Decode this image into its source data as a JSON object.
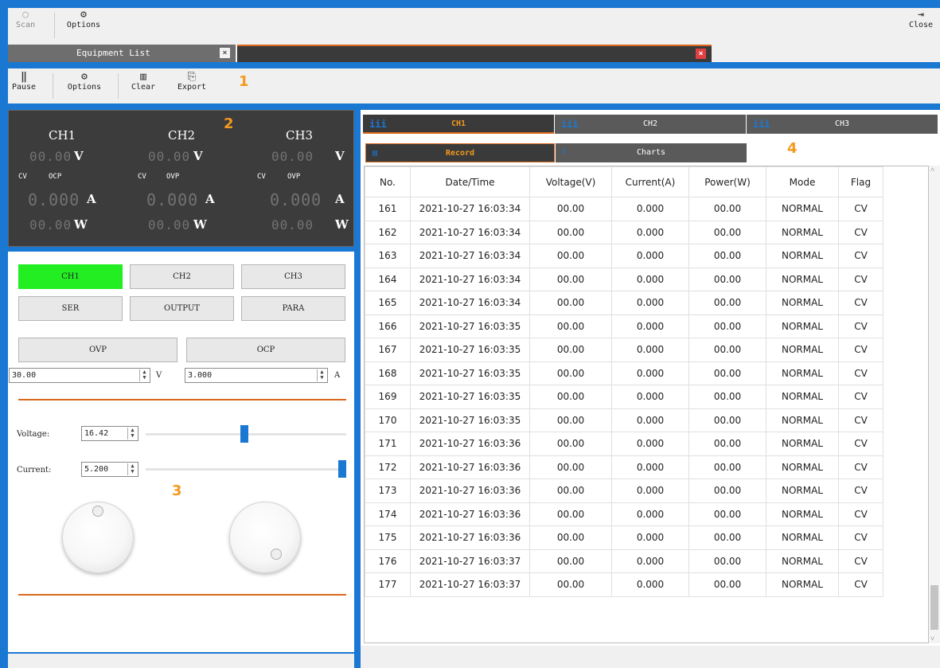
{
  "toolbar": {
    "scan": "Scan",
    "options": "Options",
    "close": "Close"
  },
  "tabs": {
    "equipment_list": "Equipment List"
  },
  "toolbar2": {
    "pause": "Pause",
    "options": "Options",
    "clear": "Clear",
    "export": "Export"
  },
  "markers": {
    "m1": "1",
    "m2": "2",
    "m3": "3",
    "m4": "4"
  },
  "display": {
    "channels": [
      {
        "name": "CH1",
        "voltage": "00.00",
        "mode": "CV",
        "prot": "OCP",
        "current": "0.000",
        "power": "00.00"
      },
      {
        "name": "CH2",
        "voltage": "00.00",
        "mode": "CV",
        "prot": "OVP",
        "current": "0.000",
        "power": "00.00"
      },
      {
        "name": "CH3",
        "voltage": "00.00",
        "mode": "CV",
        "prot": "OVP",
        "current": "0.000",
        "power": "00.00"
      }
    ],
    "units": {
      "v": "V",
      "a": "A",
      "w": "W"
    }
  },
  "control": {
    "ch1": "CH1",
    "ch2": "CH2",
    "ch3": "CH3",
    "ser": "SER",
    "output": "OUTPUT",
    "para": "PARA",
    "ovp": "OVP",
    "ocp": "OCP",
    "ovp_value": "30.00",
    "ocp_value": "3.000",
    "v_unit": "V",
    "a_unit": "A",
    "voltage_label": "Voltage:",
    "voltage_value": "16.42",
    "current_label": "Current:",
    "current_value": "5.200",
    "voltage_level": 0.49,
    "current_level": 1.0,
    "active_color": "#22ee22",
    "accent_color": "#d8681c"
  },
  "channel_tabs": [
    "CH1",
    "CH2",
    "CH3"
  ],
  "view_tabs": {
    "record": "Record",
    "charts": "Charts"
  },
  "table": {
    "headers": [
      "No.",
      "Date/Time",
      "Voltage(V)",
      "Current(A)",
      "Power(W)",
      "Mode",
      "Flag"
    ],
    "rows": [
      [
        "161",
        "2021-10-27 16:03:34",
        "00.00",
        "0.000",
        "00.00",
        "NORMAL",
        "CV"
      ],
      [
        "162",
        "2021-10-27 16:03:34",
        "00.00",
        "0.000",
        "00.00",
        "NORMAL",
        "CV"
      ],
      [
        "163",
        "2021-10-27 16:03:34",
        "00.00",
        "0.000",
        "00.00",
        "NORMAL",
        "CV"
      ],
      [
        "164",
        "2021-10-27 16:03:34",
        "00.00",
        "0.000",
        "00.00",
        "NORMAL",
        "CV"
      ],
      [
        "165",
        "2021-10-27 16:03:34",
        "00.00",
        "0.000",
        "00.00",
        "NORMAL",
        "CV"
      ],
      [
        "166",
        "2021-10-27 16:03:35",
        "00.00",
        "0.000",
        "00.00",
        "NORMAL",
        "CV"
      ],
      [
        "167",
        "2021-10-27 16:03:35",
        "00.00",
        "0.000",
        "00.00",
        "NORMAL",
        "CV"
      ],
      [
        "168",
        "2021-10-27 16:03:35",
        "00.00",
        "0.000",
        "00.00",
        "NORMAL",
        "CV"
      ],
      [
        "169",
        "2021-10-27 16:03:35",
        "00.00",
        "0.000",
        "00.00",
        "NORMAL",
        "CV"
      ],
      [
        "170",
        "2021-10-27 16:03:35",
        "00.00",
        "0.000",
        "00.00",
        "NORMAL",
        "CV"
      ],
      [
        "171",
        "2021-10-27 16:03:36",
        "00.00",
        "0.000",
        "00.00",
        "NORMAL",
        "CV"
      ],
      [
        "172",
        "2021-10-27 16:03:36",
        "00.00",
        "0.000",
        "00.00",
        "NORMAL",
        "CV"
      ],
      [
        "173",
        "2021-10-27 16:03:36",
        "00.00",
        "0.000",
        "00.00",
        "NORMAL",
        "CV"
      ],
      [
        "174",
        "2021-10-27 16:03:36",
        "00.00",
        "0.000",
        "00.00",
        "NORMAL",
        "CV"
      ],
      [
        "175",
        "2021-10-27 16:03:36",
        "00.00",
        "0.000",
        "00.00",
        "NORMAL",
        "CV"
      ],
      [
        "176",
        "2021-10-27 16:03:37",
        "00.00",
        "0.000",
        "00.00",
        "NORMAL",
        "CV"
      ],
      [
        "177",
        "2021-10-27 16:03:37",
        "00.00",
        "0.000",
        "00.00",
        "NORMAL",
        "CV"
      ]
    ]
  }
}
